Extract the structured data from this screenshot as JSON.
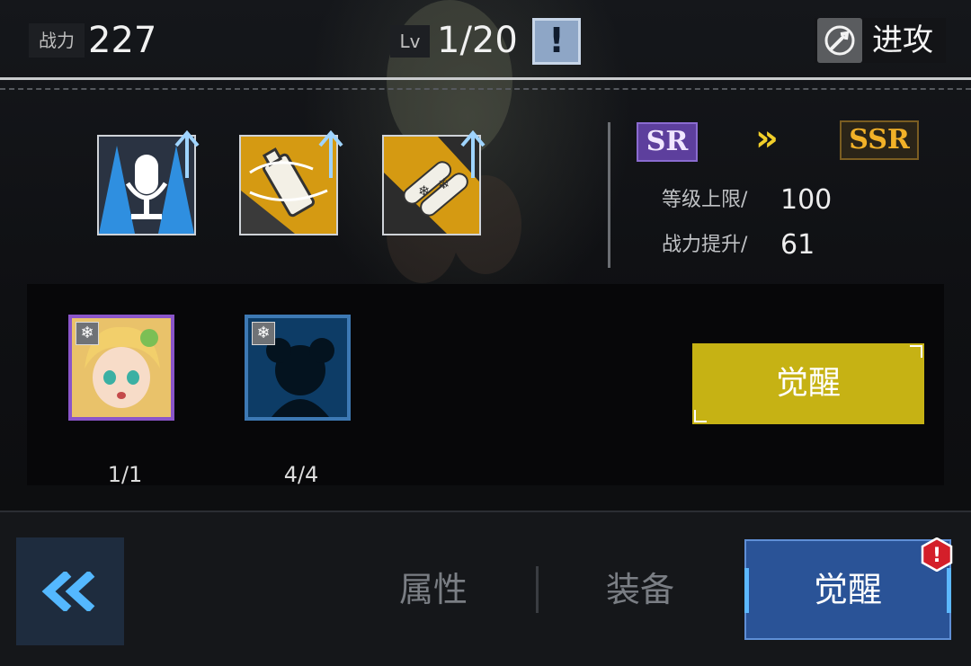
{
  "topbar": {
    "combat_power_label": "战力",
    "combat_power_value": "227",
    "level_label": "Lv",
    "level_value": "1/20",
    "info_symbol": "!",
    "attack_label": "进攻"
  },
  "skills": [
    {
      "icon": "microphone-icon",
      "upgrade": true
    },
    {
      "icon": "spray-can-icon",
      "upgrade": true
    },
    {
      "icon": "ice-missile-icon",
      "upgrade": true
    }
  ],
  "rarity": {
    "from": "SR",
    "to": "SSR",
    "arrow": "»"
  },
  "stats": [
    {
      "label": "等级上限/",
      "value": "100"
    },
    {
      "label": "战力提升/",
      "value": "61"
    }
  ],
  "materials": [
    {
      "name": "character-portrait",
      "count": "1/1",
      "badge": "❄"
    },
    {
      "name": "character-silhouette",
      "count": "4/4",
      "badge": "❄"
    }
  ],
  "awaken_button_label": "觉醒",
  "bottom_tabs": [
    {
      "label": "属性",
      "active": false
    },
    {
      "label": "装备",
      "active": false
    },
    {
      "label": "觉醒",
      "active": true
    }
  ],
  "alert_symbol": "!",
  "colors": {
    "sr_purple": "#5d3f9d",
    "ssr_gold": "#f2b128",
    "awaken_yellow": "#c6b214",
    "active_tab_blue": "#2a5397"
  }
}
